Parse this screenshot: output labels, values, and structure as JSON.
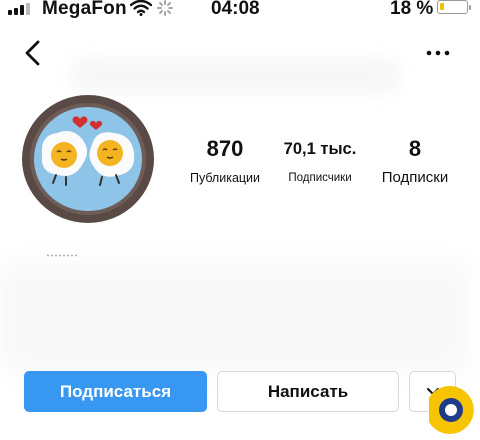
{
  "status_bar": {
    "carrier": "MegaFon",
    "time": "04:08",
    "battery_percent": "18 %",
    "battery_level": 0.18,
    "icons": [
      "signal-icon",
      "wifi-icon",
      "activity-spinner-icon",
      "battery-icon"
    ]
  },
  "header": {
    "back_icon": "chevron-left-icon",
    "more_icon": "ellipsis-icon"
  },
  "profile": {
    "avatar_icon": "avatar-fried-eggs-image",
    "stats": {
      "posts_value": "870",
      "posts_label": "Публикации",
      "followers_value": "70,1 тыс.",
      "followers_label": "Подписчики",
      "following_value": "8",
      "following_label": "Подписки"
    }
  },
  "actions": {
    "follow_label": "Подписаться",
    "message_label": "Написать",
    "more_icon": "chevron-down-icon"
  },
  "colors": {
    "accent": "#3897f0",
    "battery_low": "#f2c200",
    "logo_yellow": "#f6c400",
    "logo_blue": "#1f3c8a"
  }
}
